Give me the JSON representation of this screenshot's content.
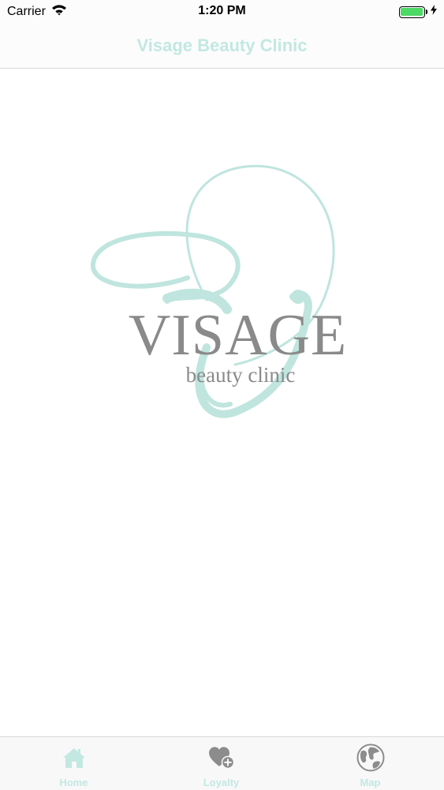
{
  "status_bar": {
    "carrier": "Carrier",
    "time": "1:20 PM",
    "battery_level": 1.0
  },
  "nav": {
    "title": "Visage Beauty Clinic"
  },
  "logo": {
    "wordmark": "VISAGE",
    "tagline": "beauty clinic"
  },
  "tab_bar": {
    "tabs": [
      {
        "label": "Home",
        "icon": "home-icon"
      },
      {
        "label": "Loyalty",
        "icon": "heart-plus-icon"
      },
      {
        "label": "Map",
        "icon": "globe-icon"
      }
    ]
  },
  "colors": {
    "accent": "#c2e8e1",
    "logo_swirl": "#bfe5de",
    "logo_text": "#8a8a8a",
    "tab_active": "#c2e8e1",
    "tab_inactive": "#c2e8e1",
    "icon_gray": "#8c8c8c",
    "battery": "#4cd964"
  }
}
